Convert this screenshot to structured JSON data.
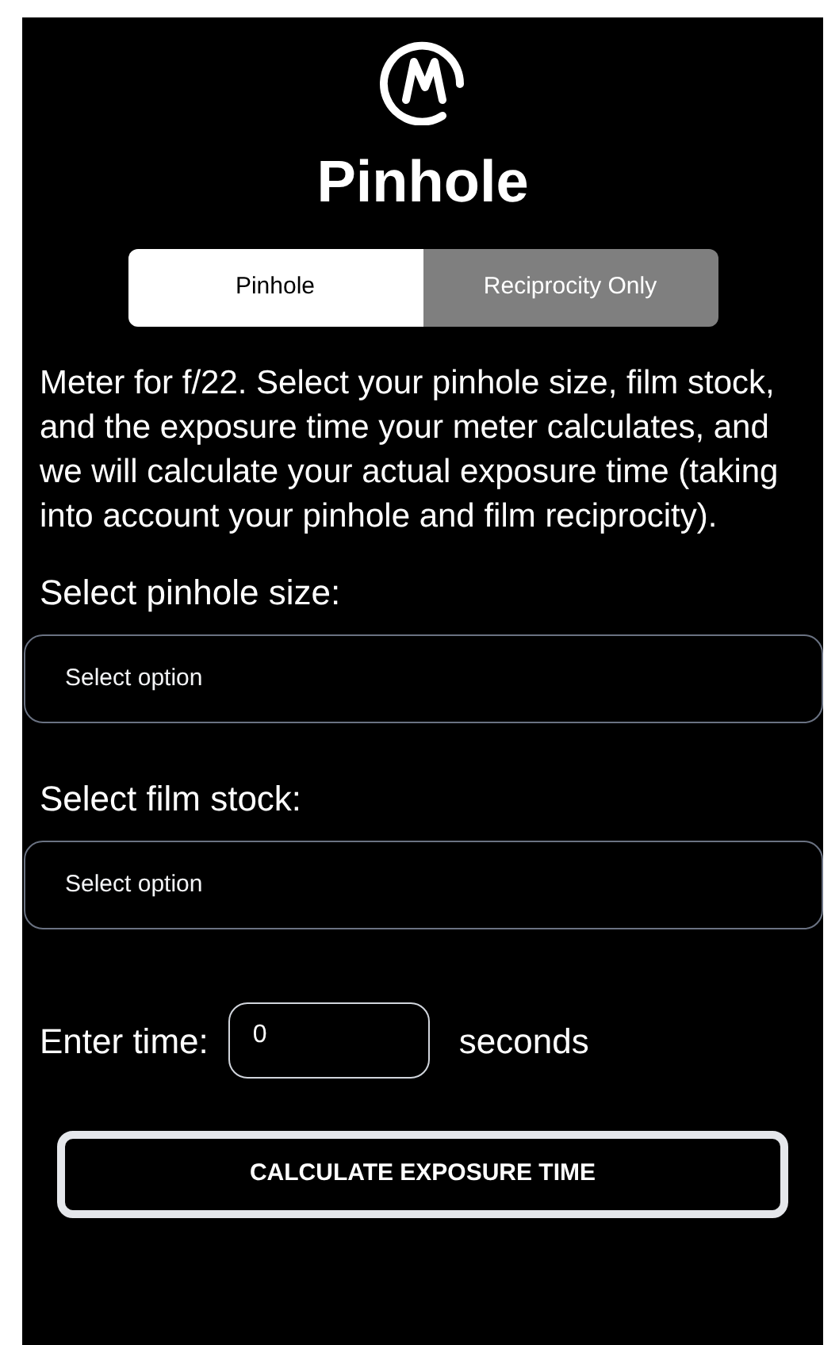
{
  "title": "Pinhole",
  "tabs": [
    {
      "label": "Pinhole",
      "selected": true
    },
    {
      "label": "Reciprocity Only",
      "selected": false
    }
  ],
  "description": "Meter for f/22. Select your pinhole size, film stock, and the exposure time your meter calculates, and we will calculate your actual exposure time (taking into account your pinhole and film reciprocity).",
  "selects": [
    {
      "label": "Select pinhole size:",
      "placeholder": "Select option"
    },
    {
      "label": "Select film stock:",
      "placeholder": "Select option"
    }
  ],
  "time": {
    "label": "Enter time:",
    "value": "0",
    "unit": "seconds"
  },
  "button": "CALCULATE EXPOSURE TIME"
}
